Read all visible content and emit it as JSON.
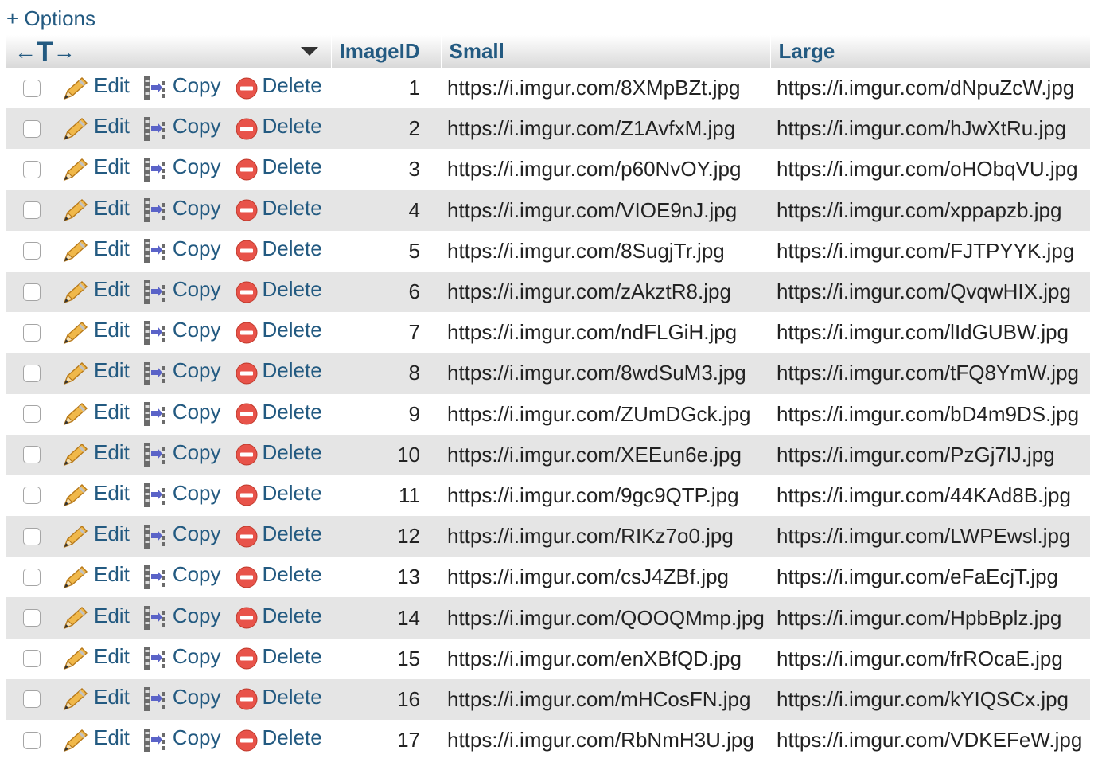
{
  "options_label": "+ Options",
  "header": {
    "arrows_left": "←",
    "arrows_t": "T",
    "arrows_right": "→",
    "columns": [
      "ImageID",
      "Small",
      "Large"
    ]
  },
  "actions": {
    "edit": "Edit",
    "copy": "Copy",
    "delete": "Delete"
  },
  "colors": {
    "link": "#235a81",
    "row_alt": "#e5e5e5",
    "delete_icon": "#e8534a"
  },
  "rows": [
    {
      "id": "1",
      "small": "https://i.imgur.com/8XMpBZt.jpg",
      "large": "https://i.imgur.com/dNpuZcW.jpg"
    },
    {
      "id": "2",
      "small": "https://i.imgur.com/Z1AvfxM.jpg",
      "large": "https://i.imgur.com/hJwXtRu.jpg"
    },
    {
      "id": "3",
      "small": "https://i.imgur.com/p60NvOY.jpg",
      "large": "https://i.imgur.com/oHObqVU.jpg"
    },
    {
      "id": "4",
      "small": "https://i.imgur.com/VIOE9nJ.jpg",
      "large": "https://i.imgur.com/xppapzb.jpg"
    },
    {
      "id": "5",
      "small": "https://i.imgur.com/8SugjTr.jpg",
      "large": "https://i.imgur.com/FJTPYYK.jpg"
    },
    {
      "id": "6",
      "small": "https://i.imgur.com/zAkztR8.jpg",
      "large": "https://i.imgur.com/QvqwHIX.jpg"
    },
    {
      "id": "7",
      "small": "https://i.imgur.com/ndFLGiH.jpg",
      "large": "https://i.imgur.com/lIdGUBW.jpg"
    },
    {
      "id": "8",
      "small": "https://i.imgur.com/8wdSuM3.jpg",
      "large": "https://i.imgur.com/tFQ8YmW.jpg"
    },
    {
      "id": "9",
      "small": "https://i.imgur.com/ZUmDGck.jpg",
      "large": "https://i.imgur.com/bD4m9DS.jpg"
    },
    {
      "id": "10",
      "small": "https://i.imgur.com/XEEun6e.jpg",
      "large": "https://i.imgur.com/PzGj7lJ.jpg"
    },
    {
      "id": "11",
      "small": "https://i.imgur.com/9gc9QTP.jpg",
      "large": "https://i.imgur.com/44KAd8B.jpg"
    },
    {
      "id": "12",
      "small": "https://i.imgur.com/RIKz7o0.jpg",
      "large": "https://i.imgur.com/LWPEwsl.jpg"
    },
    {
      "id": "13",
      "small": "https://i.imgur.com/csJ4ZBf.jpg",
      "large": "https://i.imgur.com/eFaEcjT.jpg"
    },
    {
      "id": "14",
      "small": "https://i.imgur.com/QOOQMmp.jpg",
      "large": "https://i.imgur.com/HpbBplz.jpg"
    },
    {
      "id": "15",
      "small": "https://i.imgur.com/enXBfQD.jpg",
      "large": "https://i.imgur.com/frROcaE.jpg"
    },
    {
      "id": "16",
      "small": "https://i.imgur.com/mHCosFN.jpg",
      "large": "https://i.imgur.com/kYIQSCx.jpg"
    },
    {
      "id": "17",
      "small": "https://i.imgur.com/RbNmH3U.jpg",
      "large": "https://i.imgur.com/VDKEFeW.jpg"
    }
  ]
}
